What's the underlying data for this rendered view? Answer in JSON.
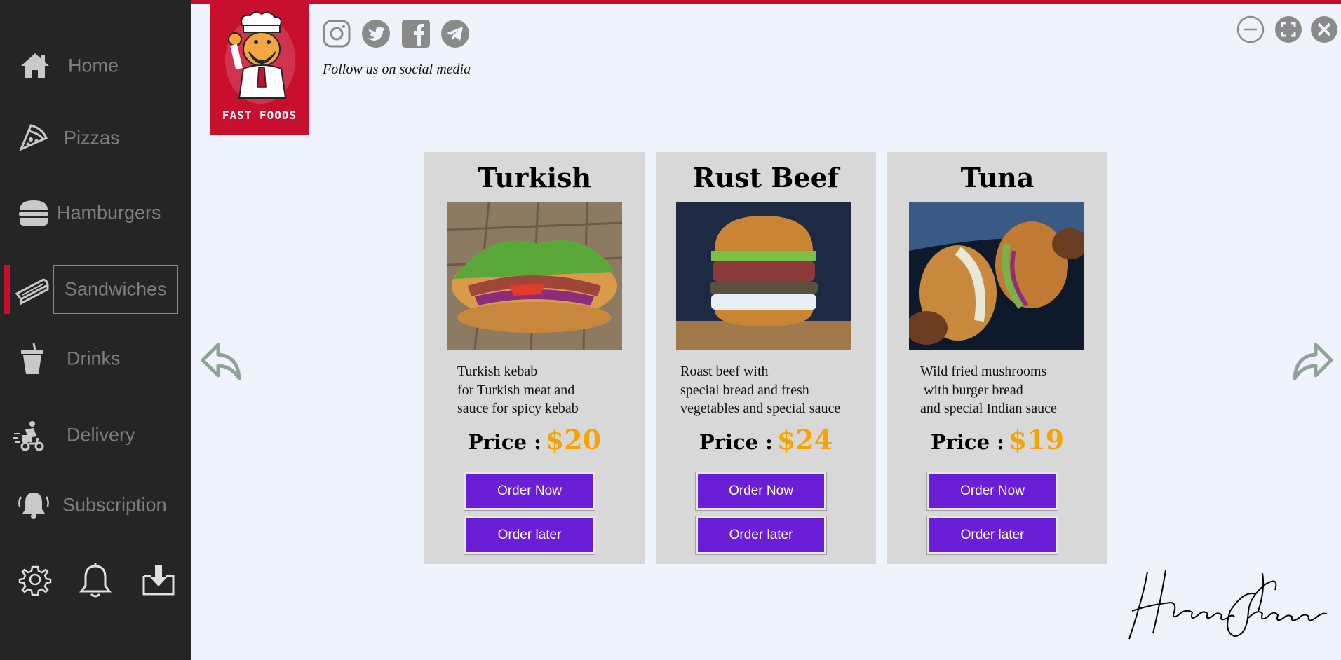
{
  "sidebar": {
    "items": [
      {
        "label": "Home",
        "icon": "home-icon"
      },
      {
        "label": "Pizzas",
        "icon": "pizza-icon"
      },
      {
        "label": "Hamburgers",
        "icon": "hamburger-icon"
      },
      {
        "label": "Sandwiches",
        "icon": "sandwich-icon",
        "active": true
      },
      {
        "label": "Drinks",
        "icon": "drink-icon"
      },
      {
        "label": "Delivery",
        "icon": "delivery-icon"
      },
      {
        "label": "Subscription",
        "icon": "subscription-icon"
      }
    ],
    "bottom_icons": [
      "gear-icon",
      "bell-icon",
      "download-icon"
    ]
  },
  "header": {
    "logo_text": "FAST FOODS",
    "social_icons": [
      "instagram-icon",
      "twitter-icon",
      "facebook-icon",
      "telegram-icon"
    ],
    "follow_text": "Follow us on social media",
    "window_controls": [
      "minimize-icon",
      "maximize-icon",
      "close-icon"
    ]
  },
  "products": [
    {
      "title": "Turkish",
      "description": "Turkish kebab\nfor Turkish meat and\nsauce for spicy kebab",
      "price_label": "Price :",
      "price": "$20",
      "order_now": "Order Now",
      "order_later": "Order later"
    },
    {
      "title": "Rust Beef",
      "description": "Roast beef with\nspecial bread and fresh\nvegetables and special sauce",
      "price_label": "Price :",
      "price": "$24",
      "order_now": "Order Now",
      "order_later": "Order later"
    },
    {
      "title": "Tuna",
      "description": "Wild fried mushrooms\n with burger bread\nand special Indian sauce",
      "price_label": "Price :",
      "price": "$19",
      "order_now": "Order Now",
      "order_later": "Order later"
    }
  ],
  "navigation": {
    "prev_icon": "back-arrow-icon",
    "next_icon": "forward-arrow-icon"
  },
  "colors": {
    "sidebar_bg": "#252525",
    "brand_red": "#c8102e",
    "button_purple": "#6a1fd6",
    "price_orange": "#f5a300",
    "card_bg": "#d8d8d8",
    "page_bg": "#eff3fb"
  }
}
